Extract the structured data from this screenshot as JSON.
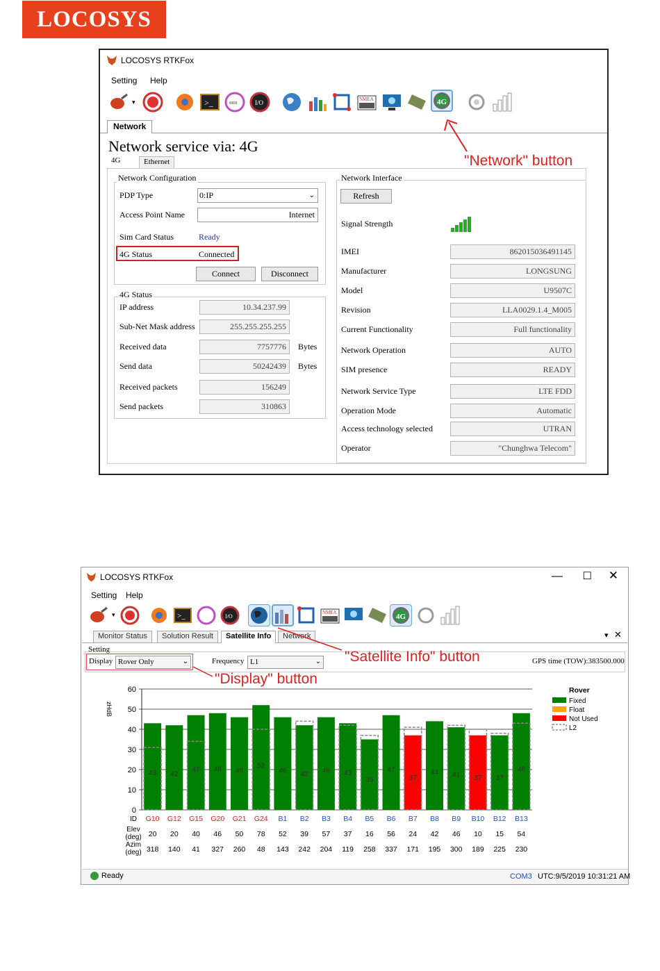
{
  "brand": {
    "logo_text": "LOCOSYS"
  },
  "win1": {
    "title": "LOCOSYS RTKFox",
    "menu": [
      "Setting",
      "Help"
    ],
    "tab": "Network",
    "heading": "Network service via: 4G",
    "subtabs": [
      "4G",
      "Ethernet"
    ],
    "netconf": {
      "title": "Network Configuration",
      "pdp_label": "PDP Type",
      "pdp_value": "0:IP",
      "apn_label": "Access Point Name",
      "apn_value": "Internet",
      "sim_label": "Sim Card Status",
      "sim_value": "Ready",
      "status_label": "4G Status",
      "status_value": "Connected",
      "connect": "Connect",
      "disconnect": "Disconnect"
    },
    "status4g": {
      "title": "4G Status",
      "rows": [
        {
          "label": "IP address",
          "value": "10.34.237.99",
          "unit": ""
        },
        {
          "label": "Sub-Net Mask address",
          "value": "255.255.255.255",
          "unit": ""
        },
        {
          "label": "Received data",
          "value": "7757776",
          "unit": "Bytes"
        },
        {
          "label": "Send data",
          "value": "50242439",
          "unit": "Bytes"
        },
        {
          "label": "Received packets",
          "value": "156249",
          "unit": ""
        },
        {
          "label": "Send packets",
          "value": "310863",
          "unit": ""
        }
      ]
    },
    "netif": {
      "title": "Network Interface",
      "refresh": "Refresh",
      "signal_label": "Signal Strength",
      "signal_level": 5,
      "rows": [
        {
          "label": "IMEI",
          "value": "862015036491145"
        },
        {
          "label": "Manufacturer",
          "value": "LONGSUNG"
        },
        {
          "label": "Model",
          "value": "U9507C"
        },
        {
          "label": "Revision",
          "value": "LLA0029.1.4_M005"
        },
        {
          "label": "Current Functionality",
          "value": "Full functionality"
        },
        {
          "label": "Network Operation",
          "value": "AUTO"
        },
        {
          "label": "SIM presence",
          "value": "READY"
        },
        {
          "label": "Network Service Type",
          "value": "LTE FDD"
        },
        {
          "label": "Operation Mode",
          "value": "Automatic"
        },
        {
          "label": "Access technology selected",
          "value": "UTRAN"
        },
        {
          "label": "Operator",
          "value": "\"Chunghwa Telecom\""
        }
      ]
    },
    "annotation": "\"Network\" button"
  },
  "win2": {
    "title": "LOCOSYS RTKFox",
    "menu": [
      "Setting",
      "Help"
    ],
    "tabs": [
      "Monitor Status",
      "Solution Result",
      "Satellite Info",
      "Network"
    ],
    "setting_label": "Setting",
    "display_label": "Display",
    "display_value": "Rover Only",
    "freq_label": "Frequency",
    "freq_value": "L1",
    "gps_time": "GPS time (TOW):383500.000",
    "ann_sat": "\"Satellite Info\" button",
    "ann_display": "\"Display\" button",
    "status_ready": "Ready",
    "status_com": "COM3",
    "status_utc": "UTC:9/5/2019 10:31:21 AM"
  },
  "chart_data": {
    "type": "bar",
    "ylabel": "zHdB",
    "ylim": [
      0,
      60
    ],
    "yticks": [
      0,
      10,
      20,
      30,
      40,
      50,
      60
    ],
    "row_labels": {
      "id": "ID",
      "elev": [
        "Elev",
        "(deg)"
      ],
      "azim": [
        "Azim",
        "(deg)"
      ]
    },
    "ids": [
      "G10",
      "G12",
      "G15",
      "G20",
      "G21",
      "G24",
      "B1",
      "B2",
      "B3",
      "B4",
      "B5",
      "B6",
      "B7",
      "B8",
      "B9",
      "B10",
      "B12",
      "B13"
    ],
    "id_colors": [
      "#e02020",
      "#e02020",
      "#e02020",
      "#e02020",
      "#e02020",
      "#e02020",
      "#2050d0",
      "#2050d0",
      "#2050d0",
      "#2050d0",
      "#2050d0",
      "#2050d0",
      "#2050d0",
      "#2050d0",
      "#2050d0",
      "#2050d0",
      "#2050d0",
      "#2050d0"
    ],
    "values": [
      43,
      42,
      47,
      48,
      46,
      52,
      46,
      42,
      46,
      43,
      35,
      47,
      37,
      44,
      41,
      37,
      37,
      48
    ],
    "status": [
      "Fixed",
      "Fixed",
      "Fixed",
      "Fixed",
      "Fixed",
      "Fixed",
      "Fixed",
      "Fixed",
      "Fixed",
      "Fixed",
      "Fixed",
      "Fixed",
      "Not Used",
      "Fixed",
      "Fixed",
      "Not Used",
      "Fixed",
      "Fixed"
    ],
    "l2": [
      31,
      null,
      34,
      null,
      null,
      40,
      null,
      44,
      null,
      42,
      37,
      null,
      41,
      null,
      42,
      40,
      38,
      43
    ],
    "elev": [
      20,
      20,
      40,
      46,
      50,
      78,
      52,
      39,
      57,
      37,
      16,
      56,
      24,
      42,
      46,
      10,
      15,
      54
    ],
    "azim": [
      318,
      140,
      41,
      327,
      260,
      48,
      143,
      242,
      204,
      119,
      258,
      337,
      171,
      195,
      300,
      189,
      225,
      230
    ],
    "legend": {
      "title": "Rover",
      "items": [
        {
          "name": "Fixed",
          "color": "#008000"
        },
        {
          "name": "Float",
          "color": "#ffa500"
        },
        {
          "name": "Not Used",
          "color": "#ff0000"
        },
        {
          "name": "L2",
          "color": "dashed"
        }
      ]
    }
  }
}
